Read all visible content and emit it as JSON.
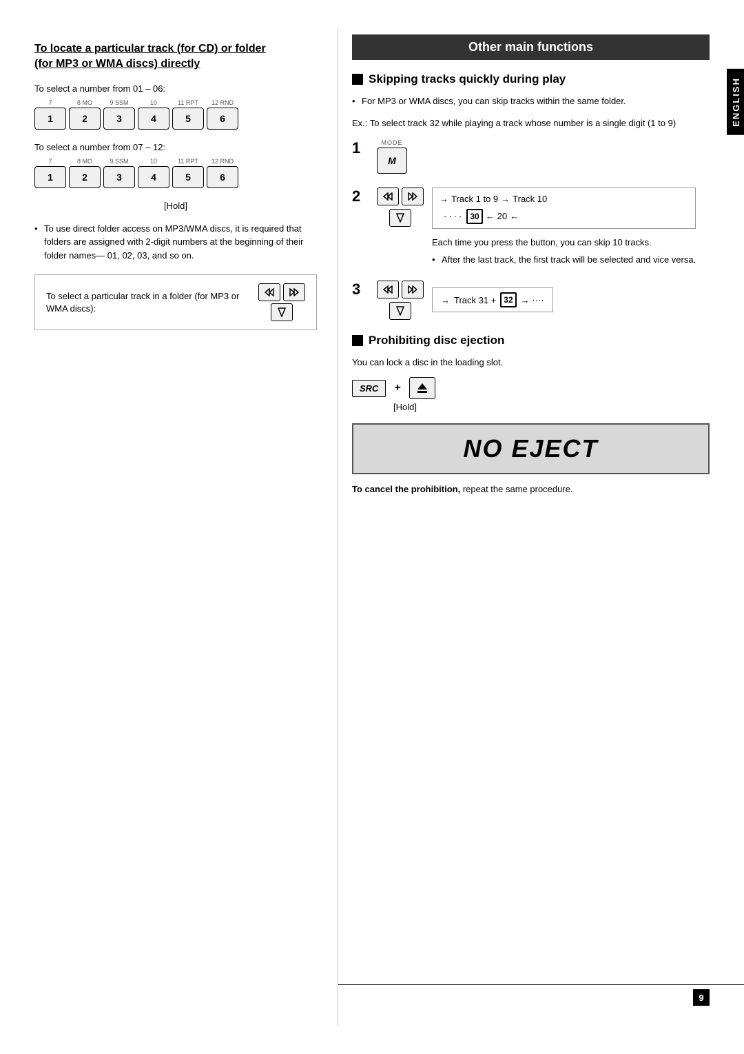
{
  "left": {
    "title_line1": "To locate a particular track (for CD) or folder",
    "title_line2": "(for MP3 or WMA discs) directly",
    "select_01_06": "To select a number from 01 – 06:",
    "select_07_12": "To select a number from 07 – 12:",
    "hold_label": "[Hold]",
    "buttons_row1": [
      {
        "label": "7",
        "sub": "",
        "main": "1"
      },
      {
        "label": "8 MO",
        "sub": "",
        "main": "2"
      },
      {
        "label": "9 SSM",
        "sub": "",
        "main": "3"
      },
      {
        "label": "10",
        "sub": "",
        "main": "4"
      },
      {
        "label": "11 RPT",
        "sub": "",
        "main": "5"
      },
      {
        "label": "12 RND",
        "sub": "",
        "main": "6"
      }
    ],
    "buttons_row2": [
      {
        "label": "7",
        "sub": "",
        "main": "1"
      },
      {
        "label": "8 MO",
        "sub": "",
        "main": "2"
      },
      {
        "label": "9 SSM",
        "sub": "",
        "main": "3"
      },
      {
        "label": "10",
        "sub": "",
        "main": "4"
      },
      {
        "label": "11 RPT",
        "sub": "",
        "main": "5"
      },
      {
        "label": "12 RND",
        "sub": "",
        "main": "6"
      }
    ],
    "bullet1": "To use direct folder access on MP3/WMA discs, it is required that folders are assigned with 2-digit numbers at the beginning of their folder names— 01, 02, 03, and so on.",
    "folder_box_text": "To select a particular track in a folder (for MP3 or WMA discs):"
  },
  "right": {
    "section_title": "Other main functions",
    "skip_title": "Skipping tracks quickly during play",
    "skip_bullet": "For MP3 or WMA discs, you can skip tracks within the same folder.",
    "ex_text": "Ex.:  To select track 32 while playing a track whose number is a single digit (1 to 9)",
    "step1_num": "1",
    "step2_num": "2",
    "step3_num": "3",
    "mode_label": "MODE",
    "mode_btn": "M",
    "track_1_to_9": "Track 1 to 9",
    "track_10": "Track 10",
    "track_30_badge": "30",
    "track_20": "20",
    "dots": "····",
    "step2_desc": "Each time you press the button, you can skip 10 tracks.",
    "step2_sub": "After the last track, the first track will be selected and vice versa.",
    "track_31_text": "Track 31 +",
    "track_32_badge": "32",
    "track_dots": "→ ····",
    "prohibit_title": "Prohibiting disc ejection",
    "prohibit_desc": "You can lock a disc in the loading slot.",
    "src_label": "SRC",
    "plus_label": "+",
    "hold_label": "[Hold]",
    "no_eject_text": "NO EJECT",
    "cancel_bold": "To cancel the prohibition,",
    "cancel_rest": " repeat the same procedure.",
    "english_label": "ENGLISH",
    "page_num": "9"
  }
}
